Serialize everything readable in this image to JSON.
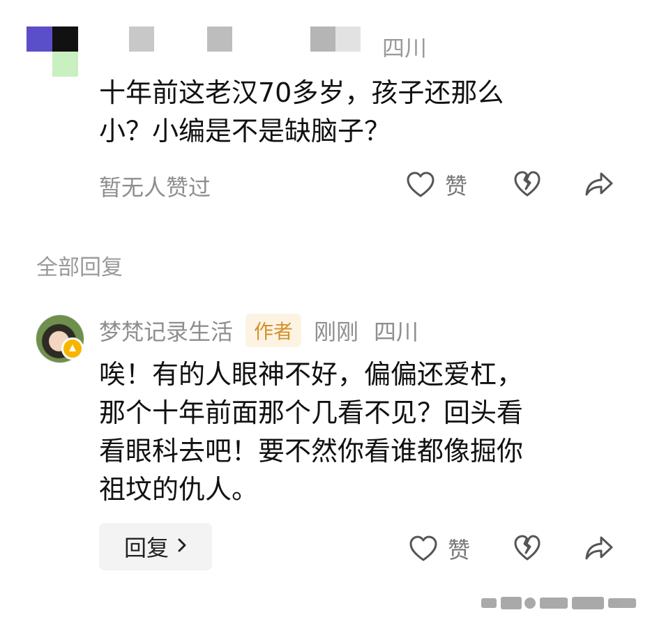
{
  "top_comment": {
    "location": "四川",
    "text_line1": "十年前这老汉70多岁，孩子还那么",
    "text_line2": "小？小编是不是缺脑子？",
    "like_status": "暂无人赞过",
    "like_label": "赞"
  },
  "section": {
    "title": "全部回复"
  },
  "reply": {
    "author": "梦梵记录生活",
    "author_tag": "作者",
    "time": "刚刚",
    "location": "四川",
    "lines": [
      "唉！有的人眼神不好，偏偏还爱杠，",
      "那个十年前面那个几看不见？回头看",
      "看眼科去吧！要不然你看谁都像掘你",
      "祖坟的仇人。"
    ],
    "reply_button": "回复",
    "like_label": "赞"
  },
  "colors": {
    "muted_text": "#8e8e8e",
    "author_tag_bg": "#fdf3e3",
    "author_tag_text": "#d3912a",
    "badge": "#f7b500"
  },
  "icons": [
    "heart-icon",
    "broken-heart-icon",
    "share-icon",
    "chevron-right-icon",
    "avatar-badge-icon"
  ]
}
